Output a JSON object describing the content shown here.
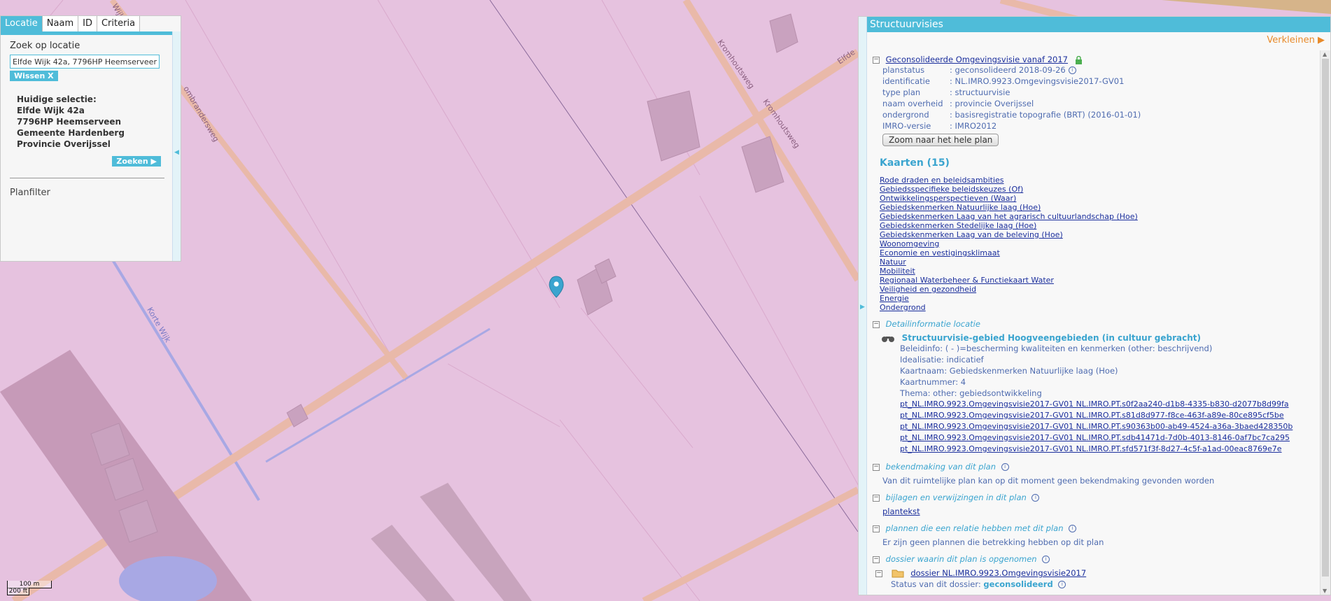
{
  "map": {
    "street_labels": [
      "Elfde",
      "Kromhoutsweg",
      "Kromhoutsweg",
      "Wijk",
      "Korte Wijk",
      "ombrandersweg"
    ],
    "marker": "location-pin-icon",
    "scale": {
      "top": "100 m",
      "bottom": "200 ft"
    },
    "colors": {
      "land": "#e6c2df",
      "road": "#e9b9a9",
      "water": "#a8a8e4",
      "marker": "#3aa4cf"
    }
  },
  "search_panel": {
    "tabs": [
      "Locatie",
      "Naam",
      "ID",
      "Criteria"
    ],
    "search_label": "Zoek op locatie",
    "search_value": "Elfde Wijk 42a, 7796HP Heemserveen",
    "clear_label": "Wissen  X",
    "selection_title": "Huidige selectie:",
    "selection_lines": [
      "Elfde Wijk 42a",
      "7796HP Heemserveen",
      "Gemeente Hardenberg",
      "Provincie Overijssel"
    ],
    "search_button": "Zoeken",
    "planfilter": "Planfilter"
  },
  "info_panel": {
    "title": "Structuurvisies",
    "shrink": "Verkleinen",
    "plan": {
      "name": "Geconsolideerde Omgevingsvisie vanaf 2017",
      "fields": [
        {
          "key": "planstatus",
          "value": ": geconsolideerd 2018-09-26"
        },
        {
          "key": "identificatie",
          "value": ": NL.IMRO.9923.Omgevingsvisie2017-GV01"
        },
        {
          "key": "type plan",
          "value": ": structuurvisie"
        },
        {
          "key": "naam overheid",
          "value": ": provincie Overijssel"
        },
        {
          "key": "ondergrond",
          "value": ": basisregistratie topografie (BRT) (2016-01-01)"
        },
        {
          "key": "IMRO-versie",
          "value": ": IMRO2012"
        }
      ],
      "zoom_button": "Zoom naar het hele plan"
    },
    "kaarten_title": "Kaarten (15)",
    "kaarten": [
      "Rode draden en beleidsambities",
      "Gebiedsspecifieke beleidskeuzes (Of)",
      "Ontwikkelingsperspectieven (Waar)",
      "Gebiedskenmerken Natuurlijke laag (Hoe)",
      "Gebiedskenmerken Laag van het agrarisch cultuurlandschap (Hoe)",
      "Gebiedskenmerken Stedelijke laag (Hoe)",
      "Gebiedskenmerken Laag van de beleving (Hoe)",
      "Woonomgeving",
      "Economie en vestigingsklimaat",
      "Natuur",
      "Mobiliteit",
      "Regionaal Waterbeheer & Functiekaart Water",
      "Veiligheid en gezondheid",
      "Energie",
      "Ondergrond"
    ],
    "detail": {
      "section_title": "Detailinformatie locatie",
      "item_title": "Structuurvisie-gebied Hoogveengebieden (in cultuur gebracht)",
      "lines": [
        "Beleidinfo: ( - )=bescherming kwaliteiten en kenmerken (other: beschrijvend)",
        "Idealisatie: indicatief",
        "Kaartnaam: Gebiedskenmerken Natuurlijke laag (Hoe)",
        "Kaartnummer: 4",
        "Thema: other: gebiedsontwikkeling"
      ],
      "links": [
        "pt_NL.IMRO.9923.Omgevingsvisie2017-GV01 NL.IMRO.PT.s0f2aa240-d1b8-4335-b830-d2077b8d99fa",
        "pt_NL.IMRO.9923.Omgevingsvisie2017-GV01 NL.IMRO.PT.s81d8d977-f8ce-463f-a89e-80ce895cf5be",
        "pt_NL.IMRO.9923.Omgevingsvisie2017-GV01 NL.IMRO.PT.s90363b00-ab49-4524-a36a-3baed428350b",
        "pt_NL.IMRO.9923.Omgevingsvisie2017-GV01 NL.IMRO.PT.sdb41471d-7d0b-4013-8146-0af7bc7ca295",
        "pt_NL.IMRO.9923.Omgevingsvisie2017-GV01 NL.IMRO.PT.sfd571f3f-8d27-4c5f-a1ad-00eac8769e7e"
      ]
    },
    "bekendmaking": {
      "title": "bekendmaking van dit plan",
      "text": "Van dit ruimtelijke plan kan op dit moment geen bekendmaking gevonden worden"
    },
    "bijlagen": {
      "title": "bijlagen en verwijzingen in dit plan",
      "link": "plantekst"
    },
    "relaties": {
      "title": "plannen die een relatie hebben met dit plan",
      "text": "Er zijn geen plannen die betrekking hebben op dit plan"
    },
    "dossier": {
      "title": "dossier waarin dit plan is opgenomen",
      "link": "dossier NL.IMRO.9923.Omgevingsvisie2017",
      "status_label": "Status van dit dossier:",
      "status_value": "geconsolideerd"
    }
  }
}
